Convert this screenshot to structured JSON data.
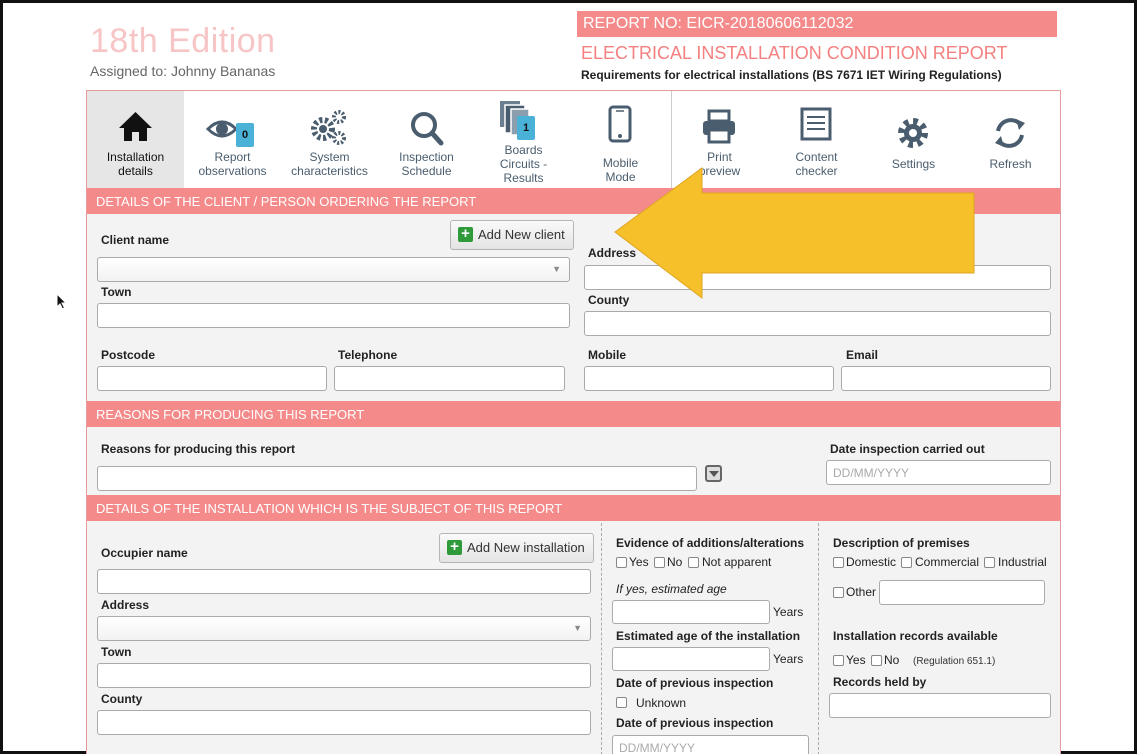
{
  "header": {
    "brand": "18th Edition",
    "assigned": "Assigned to: Johnny Bananas",
    "report_no": "REPORT NO: EICR-20180606112032",
    "report_title": "ELECTRICAL INSTALLATION CONDITION REPORT",
    "report_subtitle": "Requirements for electrical installations (BS 7671 IET Wiring Regulations)"
  },
  "toolbar": {
    "installation_details": [
      "Installation",
      "details"
    ],
    "report_observations": [
      "Report",
      "observations"
    ],
    "report_observations_badge": "0",
    "system_characteristics": [
      "System",
      "characteristics"
    ],
    "inspection_schedule": [
      "Inspection",
      "Schedule"
    ],
    "boards": [
      "Boards",
      "Circuits -",
      "Results"
    ],
    "boards_badge": "1",
    "mobile_mode": [
      "Mobile",
      "Mode"
    ],
    "print_preview": [
      "Print",
      "preview"
    ],
    "content_checker": [
      "Content",
      "checker"
    ],
    "settings": "Settings",
    "refresh": "Refresh"
  },
  "client_section": {
    "title": "DETAILS OF THE CLIENT / PERSON ORDERING THE REPORT",
    "add_button": "Add New client",
    "client_name": "Client name",
    "address": "Address",
    "town": "Town",
    "county": "County",
    "postcode": "Postcode",
    "telephone": "Telephone",
    "mobile": "Mobile",
    "email": "Email"
  },
  "reasons_section": {
    "title": "REASONS FOR PRODUCING THIS REPORT",
    "reasons_label": "Reasons for producing this report",
    "date_label": "Date inspection carried out",
    "date_placeholder": "DD/MM/YYYY"
  },
  "installation_section": {
    "title": "DETAILS OF THE INSTALLATION WHICH IS THE SUBJECT OF THIS REPORT",
    "add_button": "Add New installation",
    "occupier_name": "Occupier name",
    "address": "Address",
    "town": "Town",
    "county": "County",
    "evidence_label": "Evidence of additions/alterations",
    "evidence_options": [
      "Yes",
      "No",
      "Not apparent"
    ],
    "if_yes": "If yes, estimated age",
    "years": "Years",
    "est_age": "Estimated age of the installation",
    "prev_insp": "Date of previous inspection",
    "unknown": "Unknown",
    "prev_insp2": "Date of previous inspection",
    "date_placeholder": "DD/MM/YYYY",
    "premises_label": "Description of premises",
    "premises_options": [
      "Domestic",
      "Commercial",
      "Industrial"
    ],
    "other": "Other",
    "records_label": "Installation records available",
    "records_yes": "Yes",
    "records_no": "No",
    "regulation": "(Regulation 651.1)",
    "records_held": "Records held by"
  },
  "colors": {
    "accent": "#f48a8a",
    "arrow": "#f6c02b",
    "badge": "#49b2d6"
  }
}
